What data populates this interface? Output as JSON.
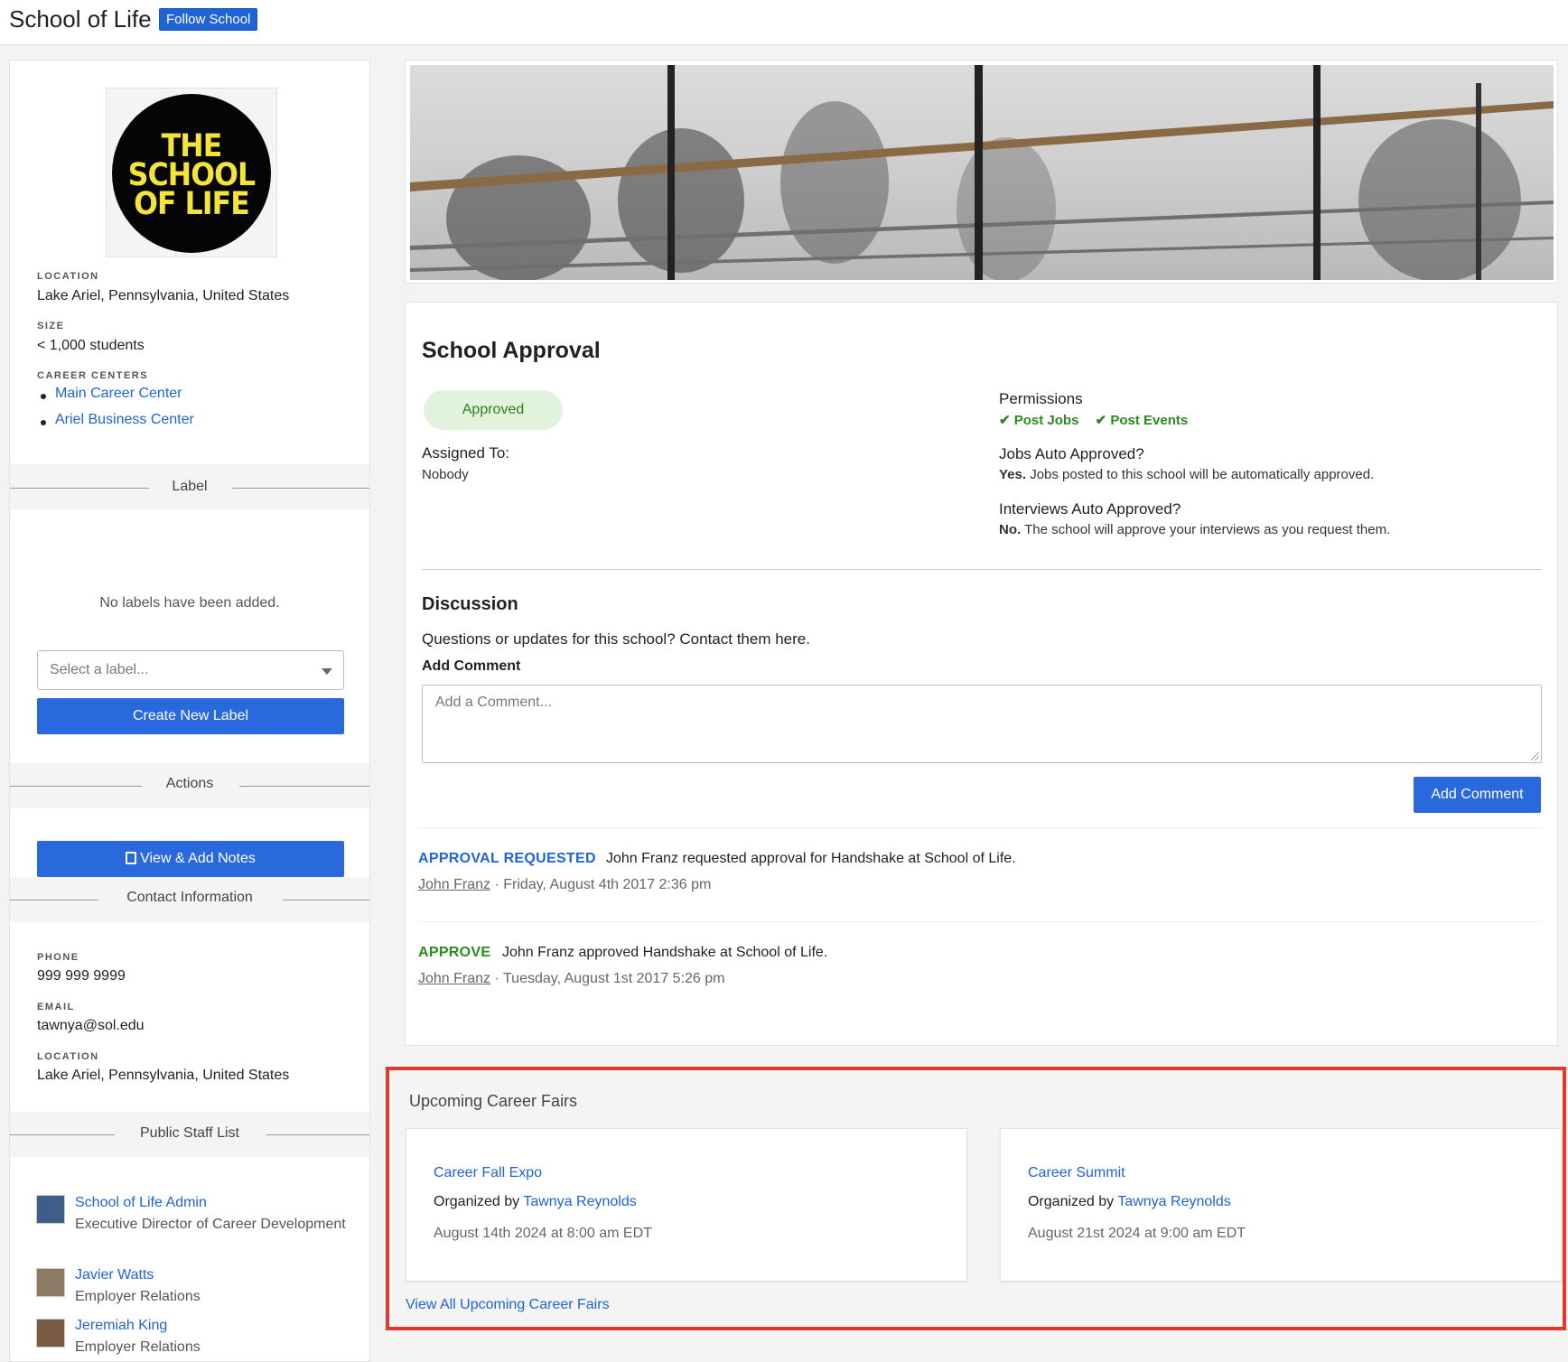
{
  "header": {
    "school_name": "School of Life",
    "follow_label": "Follow School"
  },
  "profile": {
    "logo_text": "THE SCHOOL OF LIFE",
    "location_label": "LOCATION",
    "location_value": "Lake Ariel, Pennsylvania, United States",
    "size_label": "SIZE",
    "size_value": "< 1,000 students",
    "career_centers_label": "CAREER CENTERS",
    "career_centers": [
      "Main Career Center",
      "Ariel Business Center"
    ]
  },
  "labels": {
    "section_title": "Label",
    "empty_text": "No labels have been added.",
    "select_placeholder": "Select a label...",
    "create_button": "Create New Label"
  },
  "actions": {
    "section_title": "Actions",
    "notes_button": "View & Add Notes"
  },
  "contact": {
    "section_title": "Contact Information",
    "phone_label": "PHONE",
    "phone_value": "999 999 9999",
    "email_label": "EMAIL",
    "email_value": "tawnya@sol.edu",
    "location_label": "LOCATION",
    "location_value": "Lake Ariel, Pennsylvania, United States"
  },
  "staff": {
    "section_title": "Public Staff List",
    "members": [
      {
        "name": "School of Life Admin",
        "role": "Executive Director of Career Development"
      },
      {
        "name": "Javier Watts",
        "role": "Employer Relations"
      },
      {
        "name": "Jeremiah King",
        "role": "Employer Relations"
      }
    ]
  },
  "approval": {
    "title": "School Approval",
    "status": "Approved",
    "assigned_label": "Assigned To:",
    "assigned_value": "Nobody",
    "permissions_label": "Permissions",
    "permissions": [
      "Post Jobs",
      "Post Events"
    ],
    "jobs_auto_label": "Jobs Auto Approved?",
    "jobs_auto_answer": "Yes.",
    "jobs_auto_text": "Jobs posted to this school will be automatically approved.",
    "interviews_auto_label": "Interviews Auto Approved?",
    "interviews_auto_answer": "No.",
    "interviews_auto_text": "The school will approve your interviews as you request them."
  },
  "discussion": {
    "title": "Discussion",
    "subtitle": "Questions or updates for this school? Contact them here.",
    "add_comment_label": "Add Comment",
    "comment_placeholder": "Add a Comment...",
    "add_comment_button": "Add Comment",
    "events": [
      {
        "tag": "APPROVAL REQUESTED",
        "tag_color": "#1f63d6",
        "text": "John Franz requested approval for Handshake at School of Life.",
        "author": "John Franz",
        "timestamp": "· Friday, August 4th 2017 2:36 pm"
      },
      {
        "tag": "APPROVE",
        "tag_color": "#2b8a1f",
        "text": "John Franz approved Handshake at School of Life.",
        "author": "John Franz",
        "timestamp": "· Tuesday, August 1st 2017 5:26 pm"
      }
    ]
  },
  "career_fairs": {
    "title": "Upcoming Career Fairs",
    "organized_by_label": "Organized by",
    "items": [
      {
        "name": "Career Fall Expo",
        "organizer": "Tawnya Reynolds",
        "date": "August 14th 2024 at 8:00 am EDT"
      },
      {
        "name": "Career Summit",
        "organizer": "Tawnya Reynolds",
        "date": "August 21st 2024 at 9:00 am EDT"
      }
    ],
    "view_all": "View All Upcoming Career Fairs"
  },
  "colors": {
    "accent": "#2968dd",
    "link": "#1f63d6",
    "success": "#2b8a1f",
    "highlight_border": "#e03a2e"
  }
}
